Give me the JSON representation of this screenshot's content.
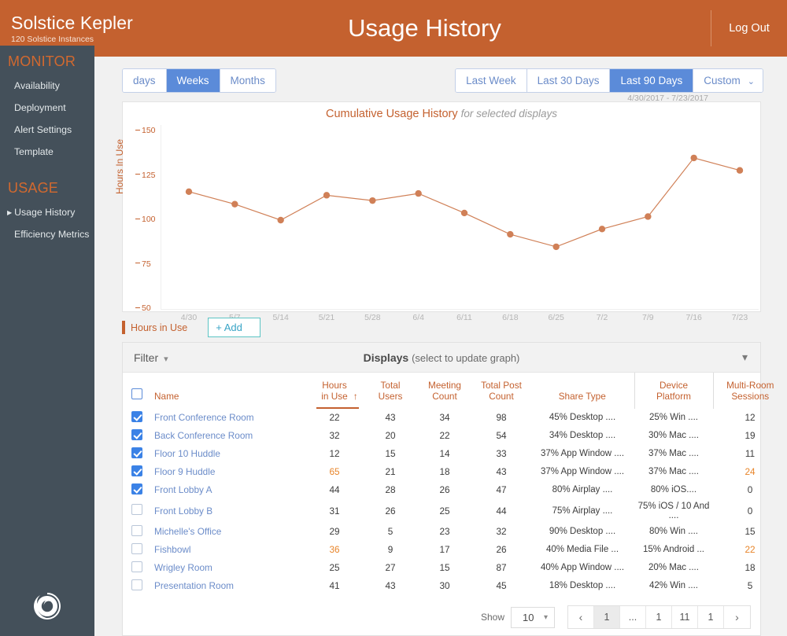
{
  "header": {
    "brand_title": "Solstice Kepler",
    "brand_subtitle": "120 Solstice Instances",
    "page_title": "Usage History",
    "logout_label": "Log Out"
  },
  "sidebar": {
    "sections": [
      {
        "heading": "MONITOR",
        "items": [
          {
            "label": "Availability",
            "active": false
          },
          {
            "label": "Deployment",
            "active": false
          },
          {
            "label": "Alert Settings",
            "active": false
          },
          {
            "label": "Template",
            "active": false
          }
        ]
      },
      {
        "heading": "USAGE",
        "items": [
          {
            "label": "Usage History",
            "active": true
          },
          {
            "label": "Efficiency Metrics",
            "active": false
          }
        ]
      }
    ]
  },
  "toolbar": {
    "granularity": [
      {
        "label": "days",
        "selected": false
      },
      {
        "label": "Weeks",
        "selected": true
      },
      {
        "label": "Months",
        "selected": false
      }
    ],
    "ranges": [
      {
        "label": "Last Week",
        "selected": false
      },
      {
        "label": "Last 30 Days",
        "selected": false
      },
      {
        "label": "Last 90 Days",
        "selected": true
      },
      {
        "label": "Custom",
        "selected": false,
        "chevron": "⌄"
      }
    ],
    "date_range": "4/30/2017 - 7/23/2017"
  },
  "chart_data": {
    "type": "line",
    "title": "Cumulative Usage History",
    "subtitle": "for selected displays",
    "xlabel": "",
    "ylabel": "Hours In Use",
    "ylim": [
      50,
      150
    ],
    "yticks": [
      150,
      125,
      100,
      75,
      50
    ],
    "grid": false,
    "legend_position": "below-left",
    "categories": [
      "4/30",
      "5/7",
      "5/14",
      "5/21",
      "5/28",
      "6/4",
      "6/11",
      "6/18",
      "6/25",
      "7/2",
      "7/9",
      "7/16",
      "7/23"
    ],
    "series": [
      {
        "name": "Hours in Use",
        "color": "#d08057",
        "values": [
          116,
          109,
          100,
          114,
          111,
          115,
          104,
          92,
          85,
          95,
          102,
          135,
          128
        ]
      }
    ]
  },
  "legend": {
    "label": "Hours in Use",
    "add_label": "+ Add"
  },
  "panel": {
    "filter_label": "Filter",
    "title": "Displays",
    "title_note": "(select to update graph)",
    "columns": [
      "Name",
      "Hours in Use",
      "Total Users",
      "Meeting Count",
      "Total Post Count",
      "Share Type",
      "Device Platform",
      "Multi-Room Sessions"
    ],
    "sort_column": "Hours in Use",
    "sort_direction": "↑",
    "rows": [
      {
        "checked": true,
        "name": "Front Conference Room",
        "hours": "22",
        "hours_hot": false,
        "users": "43",
        "meetings": "34",
        "posts": "98",
        "share": "45% Desktop ....",
        "device": "25% Win ....",
        "multi": "12",
        "multi_hot": false
      },
      {
        "checked": true,
        "name": "Back Conference Room",
        "hours": "32",
        "hours_hot": false,
        "users": "20",
        "meetings": "22",
        "posts": "54",
        "share": "34% Desktop ....",
        "device": "30% Mac ....",
        "multi": "19",
        "multi_hot": false
      },
      {
        "checked": true,
        "name": "Floor 10 Huddle",
        "hours": "12",
        "hours_hot": false,
        "users": "15",
        "meetings": "14",
        "posts": "33",
        "share": "37% App Window ....",
        "device": "37% Mac ....",
        "multi": "11",
        "multi_hot": false
      },
      {
        "checked": true,
        "name": "Floor 9 Huddle",
        "hours": "65",
        "hours_hot": true,
        "users": "21",
        "meetings": "18",
        "posts": "43",
        "share": "37% App Window ....",
        "device": "37% Mac ....",
        "multi": "24",
        "multi_hot": true
      },
      {
        "checked": true,
        "name": "Front Lobby A",
        "hours": "44",
        "hours_hot": false,
        "users": "28",
        "meetings": "26",
        "posts": "47",
        "share": "80% Airplay ....",
        "device": "80% iOS....",
        "multi": "0",
        "multi_hot": false
      },
      {
        "checked": false,
        "name": "Front Lobby B",
        "hours": "31",
        "hours_hot": false,
        "users": "26",
        "meetings": "25",
        "posts": "44",
        "share": "75% Airplay ....",
        "device": "75% iOS / 10 And ....",
        "multi": "0",
        "multi_hot": false
      },
      {
        "checked": false,
        "name": "Michelle's Office",
        "hours": "29",
        "hours_hot": false,
        "users": "5",
        "meetings": "23",
        "posts": "32",
        "share": "90% Desktop ....",
        "device": "80% Win ....",
        "multi": "15",
        "multi_hot": false
      },
      {
        "checked": false,
        "name": "Fishbowl",
        "hours": "36",
        "hours_hot": true,
        "users": "9",
        "meetings": "17",
        "posts": "26",
        "share": "40% Media File ...",
        "device": "15% Android ...",
        "multi": "22",
        "multi_hot": true
      },
      {
        "checked": false,
        "name": "Wrigley Room",
        "hours": "25",
        "hours_hot": false,
        "users": "27",
        "meetings": "15",
        "posts": "87",
        "share": "40% App Window ....",
        "device": "20% Mac ....",
        "multi": "18",
        "multi_hot": false
      },
      {
        "checked": false,
        "name": "Presentation Room",
        "hours": "41",
        "hours_hot": false,
        "users": "43",
        "meetings": "30",
        "posts": "45",
        "share": "18% Desktop ....",
        "device": "42% Win ....",
        "multi": "5",
        "multi_hot": false
      }
    ]
  },
  "pagination": {
    "show_label": "Show",
    "show_value": "10",
    "prev": "‹",
    "next": "›",
    "pages": [
      "1",
      "...",
      "1",
      "11",
      "1"
    ],
    "current_index": 0
  },
  "colors": {
    "brand_orange": "#c4612f",
    "sidebar": "#44505a",
    "accent_blue": "#5b8bd9",
    "line": "#d08057",
    "hot": "#e8852a"
  }
}
